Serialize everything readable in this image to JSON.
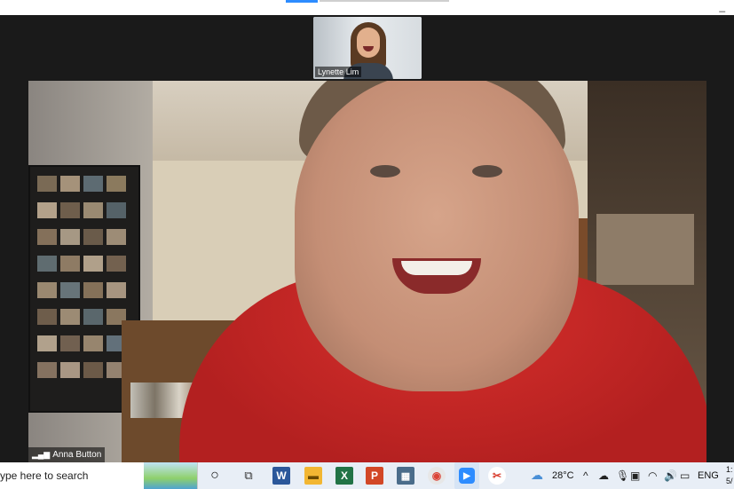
{
  "thumbnail": {
    "participant_name": "Lynette Lim"
  },
  "main_video": {
    "participant_name": "Anna Button"
  },
  "taskbar": {
    "search_placeholder": "ype here to search",
    "weather_temp": "28°C",
    "language": "ENG",
    "clock_time": "1:",
    "clock_date": "5/",
    "icons": [
      "cortana-icon",
      "task-view-icon",
      "word-icon",
      "file-explorer-icon",
      "excel-icon",
      "powerpoint-icon",
      "calculator-icon",
      "chrome-icon",
      "zoom-icon",
      "snipping-tool-icon"
    ],
    "icon_colors": {
      "word": "#2b579a",
      "explorer": "#f2b632",
      "excel": "#217346",
      "powerpoint": "#d24726",
      "calculator": "#4a6c8a",
      "zoom": "#2d8cff"
    }
  },
  "window_controls": {
    "minimize": "_"
  }
}
